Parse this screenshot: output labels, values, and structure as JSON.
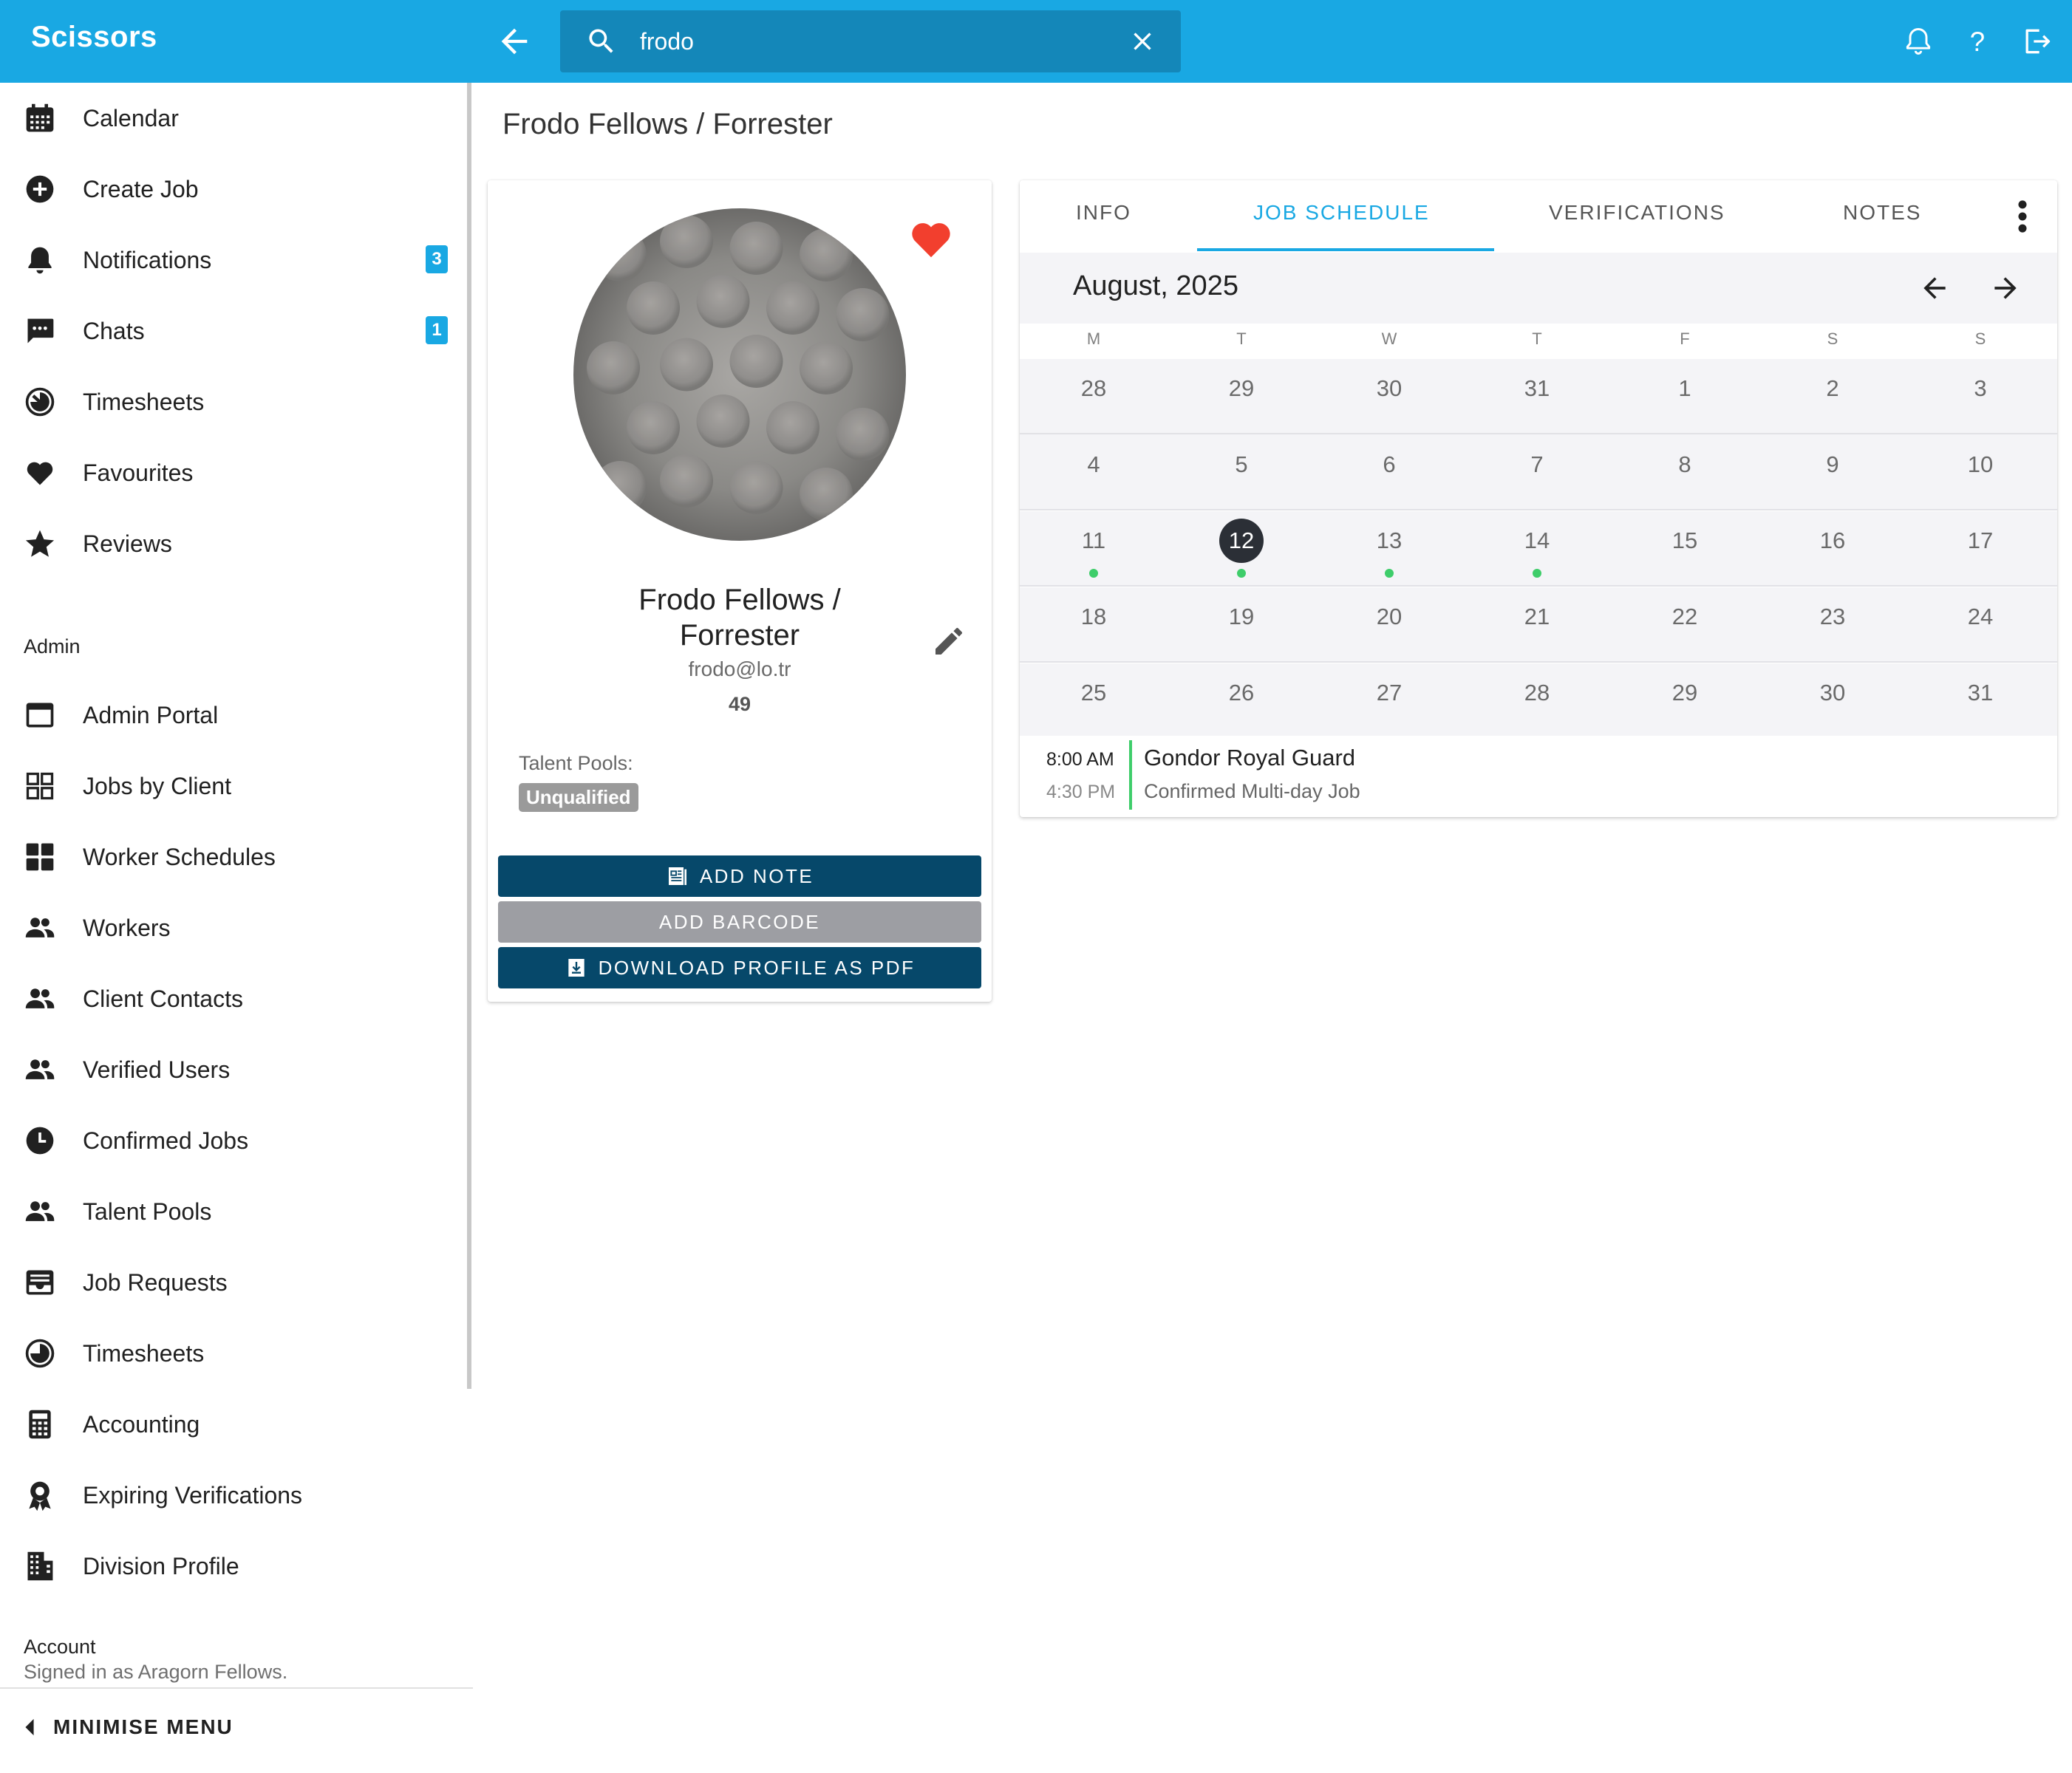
{
  "app": {
    "title": "Scissors"
  },
  "search": {
    "value": "frodo",
    "placeholder": ""
  },
  "sidebar": {
    "items": [
      {
        "label": "Calendar"
      },
      {
        "label": "Create Job"
      },
      {
        "label": "Notifications",
        "badge": "3"
      },
      {
        "label": "Chats",
        "badge": "1"
      },
      {
        "label": "Timesheets"
      },
      {
        "label": "Favourites"
      },
      {
        "label": "Reviews"
      }
    ],
    "admin_header": "Admin",
    "admin_items": [
      {
        "label": "Admin Portal"
      },
      {
        "label": "Jobs by Client"
      },
      {
        "label": "Worker Schedules"
      },
      {
        "label": "Workers"
      },
      {
        "label": "Client Contacts"
      },
      {
        "label": "Verified Users"
      },
      {
        "label": "Confirmed Jobs"
      },
      {
        "label": "Talent Pools"
      },
      {
        "label": "Job Requests"
      },
      {
        "label": "Timesheets"
      },
      {
        "label": "Accounting"
      },
      {
        "label": "Expiring Verifications"
      },
      {
        "label": "Division Profile"
      }
    ],
    "account_header": "Account",
    "account_signed_in": "Signed in as Aragorn Fellows.",
    "minimise_label": "MINIMISE MENU"
  },
  "page": {
    "title": "Frodo Fellows / Forrester"
  },
  "profile": {
    "name_line1": "Frodo Fellows /",
    "name_line2": "Forrester",
    "email": "frodo@lo.tr",
    "number": "49",
    "talent_pools_label": "Talent Pools:",
    "talent_pool_chip": "Unqualified",
    "favourite": true,
    "buttons": {
      "add_note": "ADD NOTE",
      "add_barcode": "ADD BARCODE",
      "download_pdf": "DOWNLOAD PROFILE AS PDF"
    }
  },
  "tabs": [
    {
      "label": "INFO",
      "active": false
    },
    {
      "label": "JOB SCHEDULE",
      "active": true
    },
    {
      "label": "VERIFICATIONS",
      "active": false
    },
    {
      "label": "NOTES",
      "active": false
    }
  ],
  "calendar": {
    "month": "August, 2025",
    "weekdays": [
      "M",
      "T",
      "W",
      "T",
      "F",
      "S",
      "S"
    ],
    "weeks": [
      [
        "28",
        "29",
        "30",
        "31",
        "1",
        "2",
        "3"
      ],
      [
        "4",
        "5",
        "6",
        "7",
        "8",
        "9",
        "10"
      ],
      [
        "11",
        "12",
        "13",
        "14",
        "15",
        "16",
        "17"
      ],
      [
        "18",
        "19",
        "20",
        "21",
        "22",
        "23",
        "24"
      ],
      [
        "25",
        "26",
        "27",
        "28",
        "29",
        "30",
        "31"
      ]
    ],
    "selected_day": "12",
    "days_with_jobs": [
      "11",
      "12",
      "13",
      "14"
    ],
    "event_dot_color": "#3ecd6a"
  },
  "event": {
    "start": "8:00 AM",
    "end": "4:30 PM",
    "title": "Gondor Royal Guard",
    "subtitle": "Confirmed Multi-day Job"
  },
  "colors": {
    "primary": "#19a8e3",
    "dark_button": "#06486a",
    "disabled_button": "#9d9ea3",
    "heart": "#f23f2e",
    "selected_day": "#2b2f36"
  },
  "icons": {
    "back": "arrow-left-icon",
    "search": "search-icon",
    "clear": "close-icon",
    "bell": "bell-icon",
    "help": "help-icon",
    "logout": "logout-icon"
  }
}
